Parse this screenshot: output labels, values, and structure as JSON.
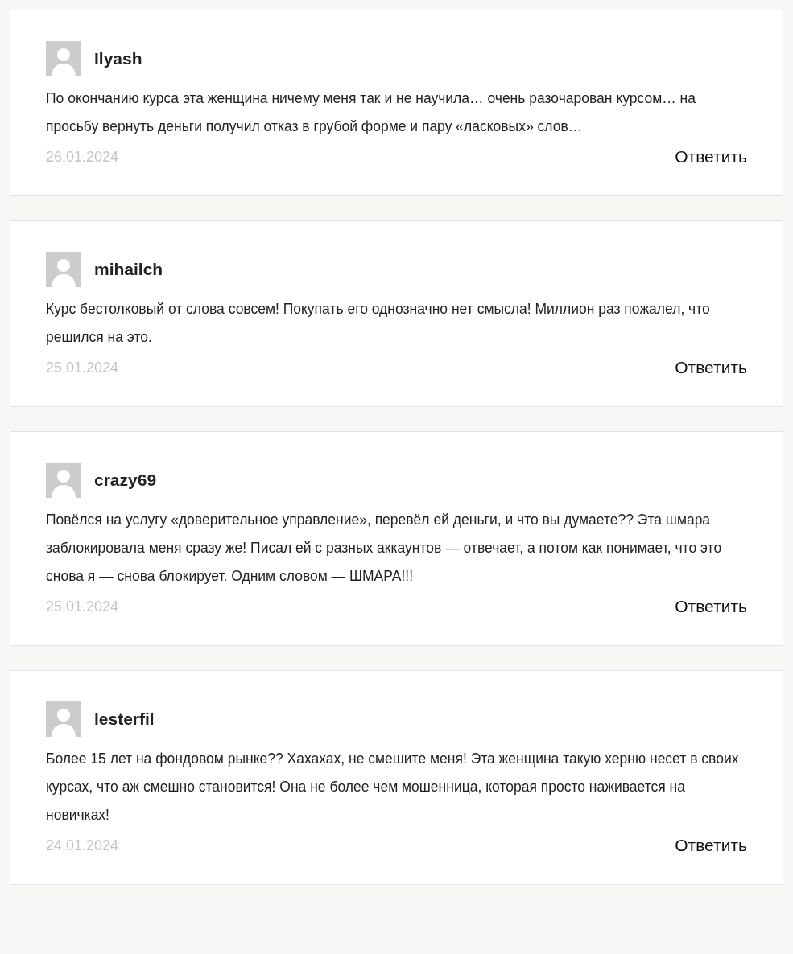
{
  "comments": [
    {
      "author": "Ilyash",
      "text": "По окончанию курса эта женщина ничему меня так и не научила… очень разочарован курсом… на просьбу вернуть деньги получил отказ в грубой форме и пару «ласковых» слов…",
      "date": "26.01.2024",
      "reply": "Ответить"
    },
    {
      "author": "mihailch",
      "text": "Курс бестолковый от слова совсем! Покупать его однозначно нет смысла! Миллион раз пожалел, что решился на это.",
      "date": "25.01.2024",
      "reply": "Ответить"
    },
    {
      "author": "crazy69",
      "text": "Повёлся на услугу «доверительное управление», перевёл ей деньги, и что вы думаете?? Эта шмара заблокировала меня сразу же! Писал ей с разных аккаунтов — отвечает, а потом как понимает, что это снова я — снова блокирует. Одним словом — ШМАРА!!!",
      "date": "25.01.2024",
      "reply": "Ответить"
    },
    {
      "author": "lesterfil",
      "text": "Более 15 лет на фондовом рынке?? Хахахах, не смешите меня! Эта женщина такую херню несет в своих курсах, что аж смешно становится! Она не более чем мошенница, которая просто наживается на новичках!",
      "date": "24.01.2024",
      "reply": "Ответить"
    }
  ]
}
